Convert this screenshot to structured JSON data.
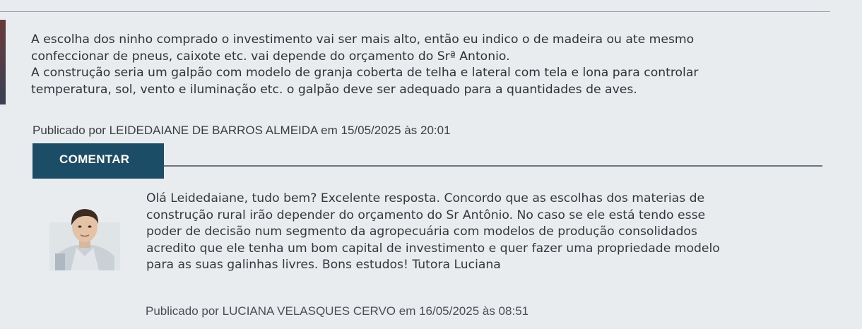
{
  "post": {
    "lines": [
      "A escolha dos ninho comprado o investimento vai ser mais alto, então eu indico o de madeira ou ate mesmo",
      "confeccionar de pneus, caixote etc. vai depende do orçamento do Srª Antonio.",
      "A construção seria um galpão com modelo de granja coberta de telha e lateral com tela e lona para controlar",
      "temperatura, sol, vento e iluminação etc. o galpão deve ser adequado para a quantidades de aves."
    ],
    "meta": "Publicado por LEIDEDAIANE DE BARROS ALMEIDA em 15/05/2025 às 20:01"
  },
  "comment_button": {
    "label": "COMENTAR"
  },
  "reply": {
    "lines": [
      "Olá Leidedaiane, tudo bem? Excelente resposta. Concordo que as escolhas dos materias de",
      "construção rural irão depender do orçamento do Sr Antônio. No caso se ele está tendo esse",
      "poder de decisão num segmento da agropecuária com modelos de produção consolidados",
      "acredito que ele tenha um bom capital de investimento e quer fazer uma propriedade modelo",
      "para as suas galinhas livres. Bons estudos! Tutora Luciana"
    ],
    "meta": "Publicado por LUCIANA VELASQUES CERVO em 16/05/2025 às 08:51"
  },
  "icons": {
    "avatar": "tutor-photo-avatar"
  },
  "colors": {
    "button_bg": "#1b4e66",
    "button_text": "#ffffff",
    "page_bg": "#e9ecee",
    "text": "#2f3338"
  }
}
